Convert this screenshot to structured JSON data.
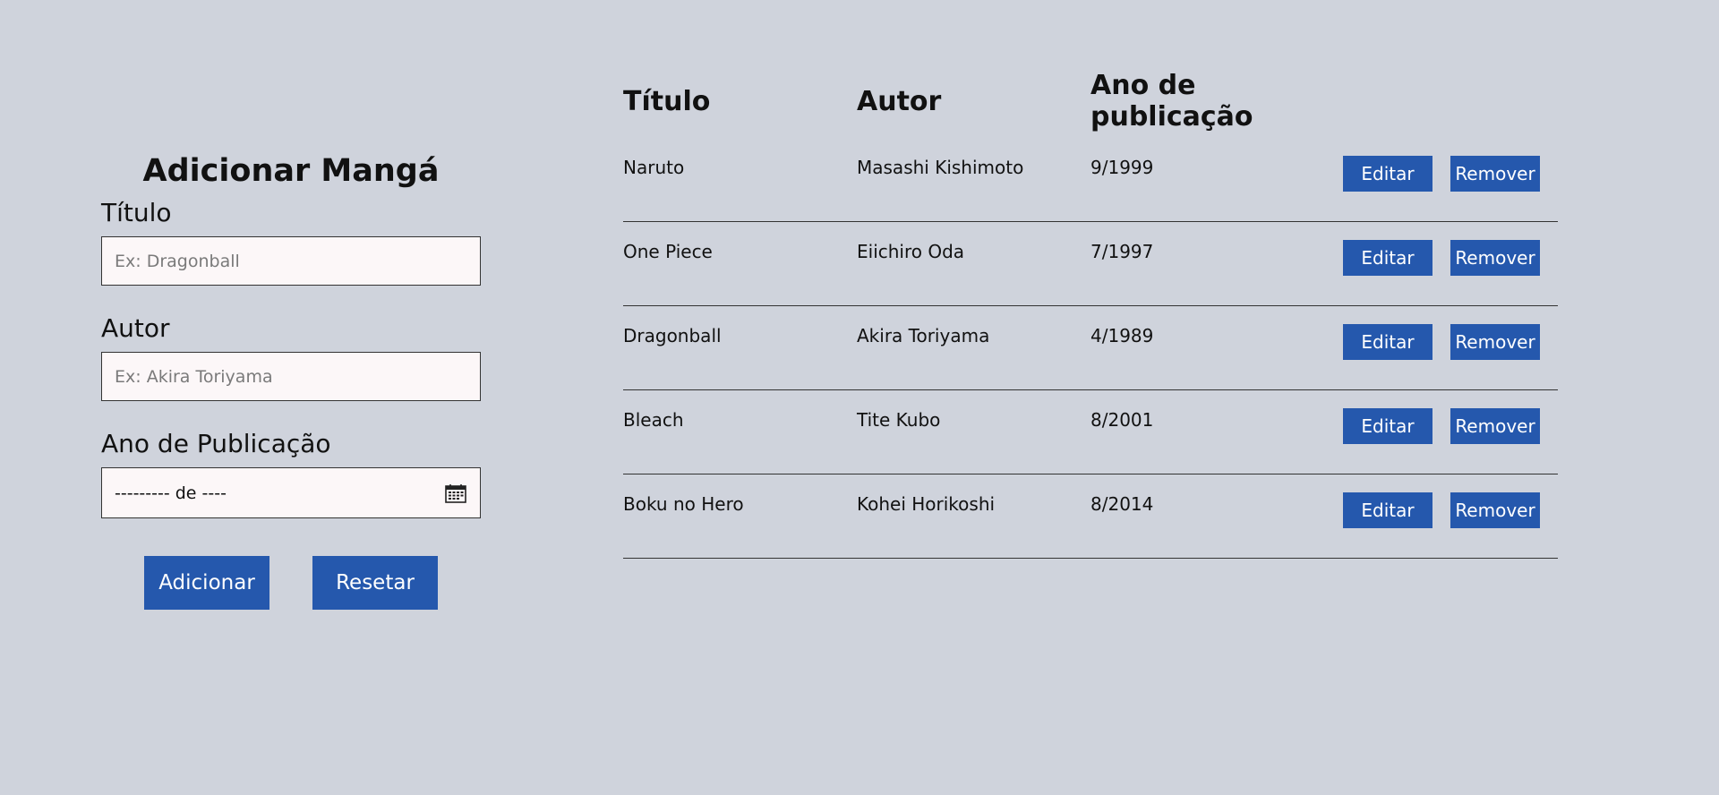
{
  "form": {
    "heading": "Adicionar Mangá",
    "title_label": "Título",
    "title_placeholder": "Ex: Dragonball",
    "author_label": "Autor",
    "author_placeholder": "Ex: Akira Toriyama",
    "year_label": "Ano de Publicação",
    "year_value": "--------- de ----",
    "calendar_icon": "calendar-icon",
    "add_button": "Adicionar",
    "reset_button": "Resetar"
  },
  "table": {
    "headers": {
      "title": "Título",
      "author": "Autor",
      "year": "Ano de publicação"
    },
    "rows": [
      {
        "title": "Naruto",
        "author": "Masashi Kishimoto",
        "year": "9/1999",
        "edit": "Editar",
        "remove": "Remover"
      },
      {
        "title": "One Piece",
        "author": "Eiichiro Oda",
        "year": "7/1997",
        "edit": "Editar",
        "remove": "Remover"
      },
      {
        "title": "Dragonball",
        "author": "Akira Toriyama",
        "year": "4/1989",
        "edit": "Editar",
        "remove": "Remover"
      },
      {
        "title": "Bleach",
        "author": "Tite Kubo",
        "year": "8/2001",
        "edit": "Editar",
        "remove": "Remover"
      },
      {
        "title": "Boku no Hero",
        "author": "Kohei Horikoshi",
        "year": "8/2014",
        "edit": "Editar",
        "remove": "Remover"
      }
    ]
  },
  "colors": {
    "background": "#cfd3dc",
    "button": "#2558ad",
    "input_background": "#fcf7f8"
  }
}
